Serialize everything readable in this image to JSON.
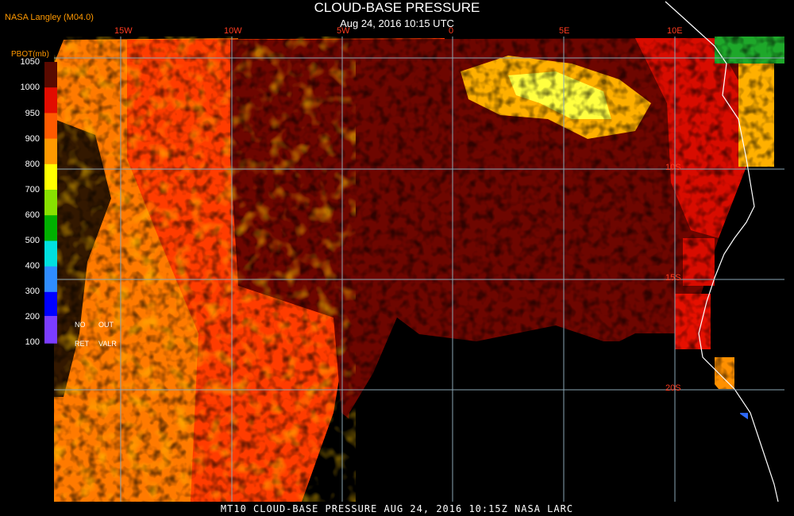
{
  "header": {
    "title": "CLOUD-BASE PRESSURE",
    "subtitle": "Aug 24, 2016 10:15 UTC",
    "brand": "NASA Langley (M04.0)"
  },
  "footer": {
    "text": "MT10   CLOUD-BASE PRESSURE   AUG 24, 2016 10:15Z   NASA LARC"
  },
  "legend": {
    "title": "PBOT(mb)",
    "ticks": [
      "1050",
      "1000",
      "950",
      "900",
      "800",
      "700",
      "600",
      "500",
      "400",
      "300",
      "200",
      "100"
    ],
    "colors": [
      "#5a0a00",
      "#e20c00",
      "#ff5a00",
      "#ff9900",
      "#ffff00",
      "#88e000",
      "#00b000",
      "#00e0e0",
      "#2f8cff",
      "#0000ff",
      "#7b3cff"
    ],
    "nodata_labels": [
      "NO",
      "OUT",
      "RET",
      "VALR"
    ]
  },
  "grid": {
    "longitude_labels": [
      "15W",
      "10W",
      "5W",
      "0",
      "5E",
      "10E"
    ],
    "latitude_labels": [
      "10S",
      "15S",
      "20S"
    ],
    "line_color": "#8aa6b4"
  },
  "map_colors": {
    "background": "#000000",
    "coastline": "#ffffff",
    "deep_red": "#6e0600",
    "red": "#e61000",
    "orange_red": "#ff4a00",
    "orange": "#ff9000",
    "yellow": "#ffff40",
    "green": "#1ea82a"
  }
}
